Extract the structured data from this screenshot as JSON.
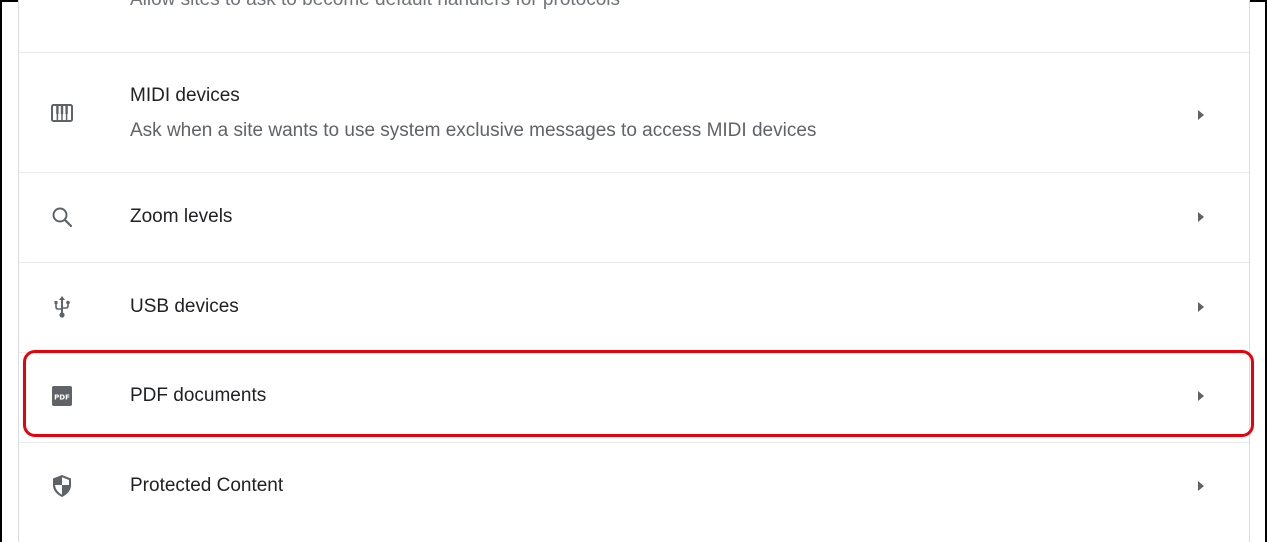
{
  "settings": {
    "cut_off_row": {
      "description": "Allow sites to ask to become default handlers for protocols"
    },
    "rows": [
      {
        "title": "MIDI devices",
        "subtitle": "Ask when a site wants to use system exclusive messages to access MIDI devices",
        "icon": "midi-keyboard-icon"
      },
      {
        "title": "Zoom levels",
        "icon": "search-icon"
      },
      {
        "title": "USB devices",
        "icon": "usb-icon"
      },
      {
        "title": "PDF documents",
        "icon": "pdf-icon"
      },
      {
        "title": "Protected Content",
        "icon": "shield-icon"
      }
    ]
  },
  "annotation": {
    "highlight_color": "#e8000b",
    "highlighted_row": "PDF documents"
  }
}
